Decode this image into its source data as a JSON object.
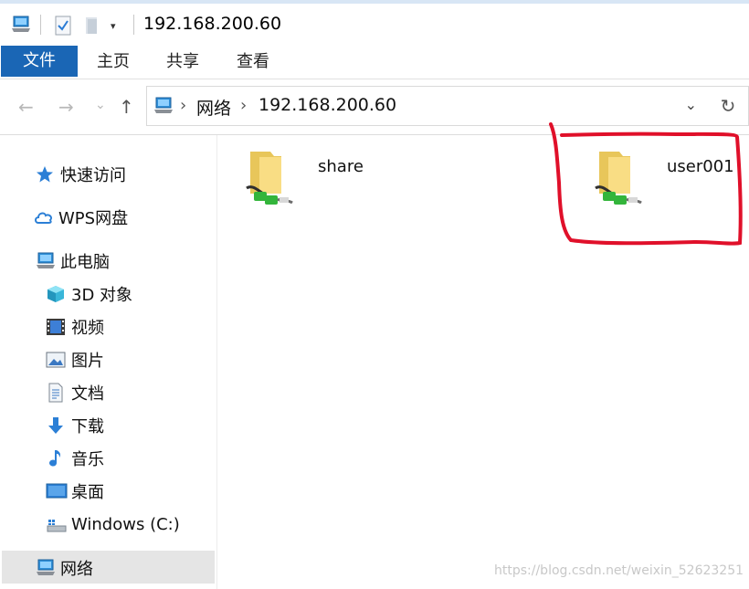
{
  "window": {
    "title": "192.168.200.60"
  },
  "ribbon": {
    "tabs": [
      "文件",
      "主页",
      "共享",
      "查看"
    ]
  },
  "address": {
    "crumbs": [
      "网络",
      "192.168.200.60"
    ],
    "back": "←",
    "forward": "→",
    "recent": "⌄",
    "up": "↑",
    "dropdown": "⌄",
    "refresh": "↻"
  },
  "sidebar": {
    "quick_access": "快速访问",
    "wps": "WPS网盘",
    "this_pc": "此电脑",
    "items": [
      "3D 对象",
      "视频",
      "图片",
      "文档",
      "下载",
      "音乐",
      "桌面",
      "Windows (C:)"
    ],
    "network": "网络"
  },
  "content": {
    "shares": [
      "share",
      "user001"
    ]
  },
  "watermark": "https://blog.csdn.net/weixin_52623251",
  "colors": {
    "file_tab": "#1a66b5",
    "selected": "#e5e5e5",
    "highlight": "#e0102a"
  }
}
